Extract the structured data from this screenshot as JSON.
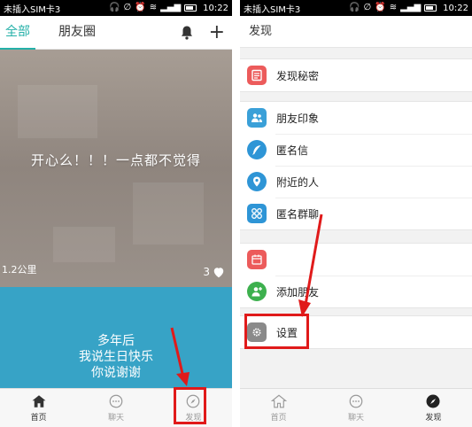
{
  "statusbar": {
    "carrier": "未插入SIM卡3",
    "time": "10:22"
  },
  "left": {
    "tabs": [
      {
        "label": "全部",
        "active": true
      },
      {
        "label": "朋友圈",
        "active": false
      }
    ],
    "card1": {
      "text": "开心么！！！一点都不觉得",
      "distance": "1.2公里",
      "likes": "3"
    },
    "card2": {
      "lines": [
        "多年后",
        "我说生日快乐",
        "你说谢谢"
      ]
    },
    "bottom_nav": [
      {
        "label": "首页",
        "icon": "home-icon"
      },
      {
        "label": "聊天",
        "icon": "chat-icon"
      },
      {
        "label": "发现",
        "icon": "compass-icon"
      }
    ]
  },
  "right": {
    "title": "发现",
    "groups": [
      [
        {
          "label": "发现秘密",
          "icon": "document-icon",
          "color": "#ec5b5b"
        }
      ],
      [
        {
          "label": "朋友印象",
          "icon": "people-icon",
          "color": "#3aa0d8"
        },
        {
          "label": "匿名信",
          "icon": "feather-icon",
          "color": "#2e95d6"
        },
        {
          "label": "附近的人",
          "icon": "location-icon",
          "color": "#2e95d6"
        },
        {
          "label": "匿名群聊",
          "icon": "grid-icon",
          "color": "#2e95d6"
        }
      ],
      [
        {
          "label": "",
          "icon": "calendar-icon",
          "color": "#ec5b5b"
        },
        {
          "label": "添加朋友",
          "icon": "add-user-icon",
          "color": "#3db04e"
        }
      ],
      [
        {
          "label": "设置",
          "icon": "gear-icon",
          "color": "#8a8a8a"
        }
      ]
    ],
    "bottom_nav": [
      {
        "label": "首页",
        "icon": "home-icon"
      },
      {
        "label": "聊天",
        "icon": "chat-icon"
      },
      {
        "label": "发现",
        "icon": "compass-icon"
      }
    ]
  },
  "colors": {
    "accent": "#24b0a8",
    "highlight": "#e01a1a"
  }
}
